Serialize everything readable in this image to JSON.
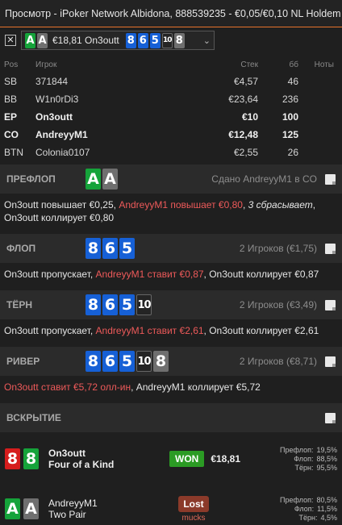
{
  "window": {
    "title": "Просмотр - iPoker Network Albidona, 888539235 - €0,05/€0,10 NL Holdem 6-max"
  },
  "hand_selector": {
    "close_symbol": "✕",
    "hole_cards": [
      {
        "rank": "A",
        "suit": "c"
      },
      {
        "rank": "A",
        "suit": "s"
      }
    ],
    "amount": "€18,81 On3outt",
    "board": [
      {
        "rank": "8",
        "suit": "d"
      },
      {
        "rank": "6",
        "suit": "d"
      },
      {
        "rank": "5",
        "suit": "d"
      },
      {
        "rank": "10",
        "suit": "dark"
      },
      {
        "rank": "8",
        "suit": "s"
      }
    ],
    "chevron": "⌄"
  },
  "players_table": {
    "headers": {
      "pos": "Pos",
      "player": "Игрок",
      "stack": "Стек",
      "bb": "бб",
      "notes": "Ноты"
    },
    "rows": [
      {
        "pos": "SB",
        "name": "371844",
        "stack": "€4,57",
        "bb": "46",
        "bold": false
      },
      {
        "pos": "BB",
        "name": "W1n0rDi3",
        "stack": "€23,64",
        "bb": "236",
        "bold": false
      },
      {
        "pos": "EP",
        "name": "On3outt",
        "stack": "€10",
        "bb": "100",
        "bold": true
      },
      {
        "pos": "CO",
        "name": "AndreyyM1",
        "stack": "€12,48",
        "bb": "125",
        "bold": true
      },
      {
        "pos": "BTN",
        "name": "Colonia0107",
        "stack": "€2,55",
        "bb": "26",
        "bold": false
      }
    ]
  },
  "preflop": {
    "label": "ПРЕФЛОП",
    "cards": [
      {
        "rank": "A",
        "suit": "c"
      },
      {
        "rank": "A",
        "suit": "s"
      }
    ],
    "info": "Сдано AndreyyM1 в CO",
    "actions": {
      "a1": "On3outt повышает €0,25, ",
      "a2": "AndreyyM1 повышает €0,80",
      "a3": ", ",
      "a4": "3 сбрасывает",
      "a5": ", On3outt коллирует €0,80"
    }
  },
  "flop": {
    "label": "ФЛОП",
    "cards": [
      {
        "rank": "8",
        "suit": "d"
      },
      {
        "rank": "6",
        "suit": "d"
      },
      {
        "rank": "5",
        "suit": "d"
      }
    ],
    "info": "2 Игроков (€1,75)",
    "actions": {
      "a1": "On3outt пропускает, ",
      "a2": "AndreyyM1 ставит €0,87",
      "a3": ", On3outt коллирует €0,87"
    }
  },
  "turn": {
    "label": "ТЁРН",
    "cards": [
      {
        "rank": "8",
        "suit": "d"
      },
      {
        "rank": "6",
        "suit": "d"
      },
      {
        "rank": "5",
        "suit": "d"
      },
      {
        "rank": "10",
        "suit": "dark"
      }
    ],
    "info": "2 Игроков (€3,49)",
    "actions": {
      "a1": "On3outt пропускает, ",
      "a2": "AndreyyM1 ставит €2,61",
      "a3": ", On3outt коллирует €2,61"
    }
  },
  "river": {
    "label": "РИВЕР",
    "cards": [
      {
        "rank": "8",
        "suit": "d"
      },
      {
        "rank": "6",
        "suit": "d"
      },
      {
        "rank": "5",
        "suit": "d"
      },
      {
        "rank": "10",
        "suit": "dark"
      },
      {
        "rank": "8",
        "suit": "s"
      }
    ],
    "info": "2 Игроков (€8,71)",
    "actions": {
      "a1": "On3outt ставит €5,72 олл-ин",
      "a2": ", AndreyyM1 коллирует €5,72"
    }
  },
  "showdown": {
    "label": "ВСКРЫТИЕ",
    "winner": {
      "cards": [
        {
          "rank": "8",
          "suit": "h"
        },
        {
          "rank": "8",
          "suit": "c"
        }
      ],
      "name": "On3outt",
      "hand": "Four of a Kind",
      "badge": "WON",
      "amount": "€18,81",
      "equity": [
        {
          "street": "Префлоп:",
          "value": "19,5%"
        },
        {
          "street": "Флоп:",
          "value": "88,5%"
        },
        {
          "street": "Тёрн:",
          "value": "95,5%"
        }
      ]
    },
    "loser": {
      "cards": [
        {
          "rank": "A",
          "suit": "c"
        },
        {
          "rank": "A",
          "suit": "s"
        }
      ],
      "name": "AndreyyM1",
      "hand": "Two Pair",
      "badge": "Lost",
      "note": "mucks",
      "equity": [
        {
          "street": "Префлоп:",
          "value": "80,5%"
        },
        {
          "street": "Флоп:",
          "value": "11,5%"
        },
        {
          "street": "Тёрн:",
          "value": "4,5%"
        }
      ]
    }
  }
}
